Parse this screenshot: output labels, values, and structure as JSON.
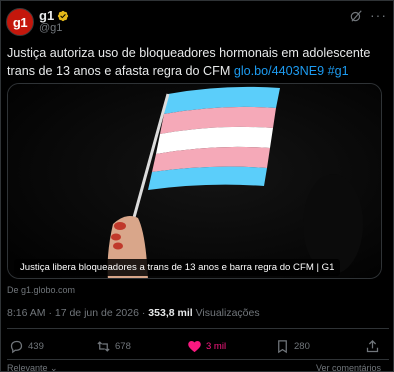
{
  "account": {
    "avatar_text": "g1",
    "name": "g1",
    "handle": "@g1"
  },
  "tweet": {
    "text": "Justiça autoriza uso de bloqueadores hormonais em adolescente trans de 13 anos e afasta regra do CFM ",
    "link": "glo.bo/4403NE9",
    "hashtag": "#g1"
  },
  "media": {
    "caption": "Justiça libera bloqueadores a trans de 13 anos e barra regra do CFM | G1",
    "flag_colors": [
      "#5bcefa",
      "#f5a9b8",
      "#ffffff",
      "#f5a9b8",
      "#5bcefa"
    ]
  },
  "source_line": "De g1.globo.com",
  "meta": {
    "time": "8:16 AM",
    "date": "17 de jun de 2026",
    "views": "353,8 mil",
    "views_label": "Visualizações"
  },
  "actions": {
    "replies": "439",
    "reposts": "678",
    "likes": "3 mil",
    "bookmarks": "280"
  },
  "footer": {
    "left": "Relevante",
    "right": "Ver comentários"
  },
  "colors": {
    "accent_link": "#1d9bf0",
    "like": "#f91880",
    "muted": "#71767b"
  }
}
